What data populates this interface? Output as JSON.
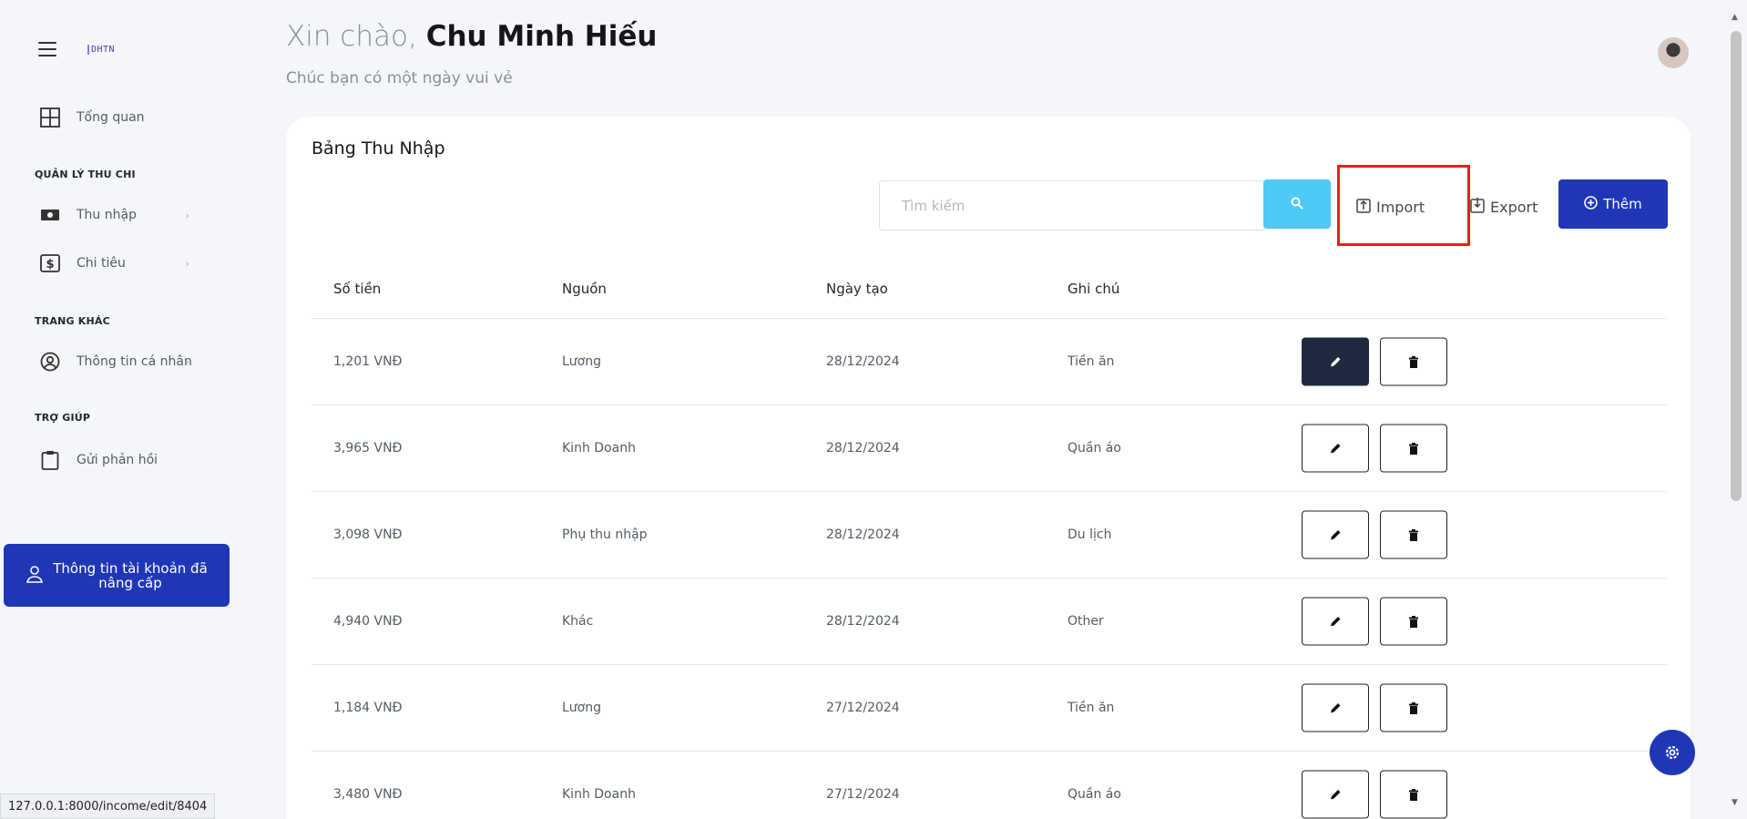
{
  "sidebar": {
    "logo_text": "DHTN",
    "overview_label": "Tổng quan",
    "section_finance": "QUẢN LÝ THU CHI",
    "income_label": "Thu nhập",
    "expense_label": "Chi tiêu",
    "section_other": "TRANG KHÁC",
    "profile_label": "Thông tin cá nhân",
    "section_help": "TRỢ GIÚP",
    "feedback_label": "Gửi phản hồi",
    "upgrade_label": "Thông tin tài khoản đã nâng cấp"
  },
  "header": {
    "greeting_prefix": "Xin chào,",
    "user_name": "Chu Minh Hiếu",
    "subtitle": "Chúc bạn có một ngày vui vẻ"
  },
  "card": {
    "title": "Bảng Thu Nhập",
    "search_placeholder": "Tìm kiếm",
    "import_label": "Import",
    "export_label": "Export",
    "add_label": "Thêm"
  },
  "table": {
    "columns": [
      "Số tiền",
      "Nguồn",
      "Ngày tạo",
      "Ghi chú"
    ],
    "rows": [
      {
        "amount": "1,201 VNĐ",
        "source": "Lương",
        "date": "28/12/2024",
        "note": "Tiền ăn"
      },
      {
        "amount": "3,965 VNĐ",
        "source": "Kinh Doanh",
        "date": "28/12/2024",
        "note": "Quần áo"
      },
      {
        "amount": "3,098 VNĐ",
        "source": "Phụ thu nhập",
        "date": "28/12/2024",
        "note": "Du lịch"
      },
      {
        "amount": "4,940 VNĐ",
        "source": "Khác",
        "date": "28/12/2024",
        "note": "Other"
      },
      {
        "amount": "1,184 VNĐ",
        "source": "Lương",
        "date": "27/12/2024",
        "note": "Tiền ăn"
      },
      {
        "amount": "3,480 VNĐ",
        "source": "Kinh Doanh",
        "date": "27/12/2024",
        "note": "Quần áo"
      }
    ]
  },
  "status_bar": {
    "url": "127.0.0.1:8000/income/edit/8404"
  },
  "colors": {
    "primary": "#1f37b6",
    "search_button": "#4fc9f5",
    "highlight": "#ee1c1c",
    "active_edit": "#1f2a3f"
  },
  "icons": {
    "menu": "hamburger-icon",
    "overview": "grid-icon",
    "income": "cash-icon",
    "expense": "dollar-icon",
    "profile": "user-circle-icon",
    "feedback": "clipboard-icon",
    "search": "search-icon",
    "import": "upload-icon",
    "export": "download-icon",
    "add": "plus-circle-icon",
    "edit": "pencil-icon",
    "delete": "trash-icon",
    "settings": "gear-icon"
  }
}
